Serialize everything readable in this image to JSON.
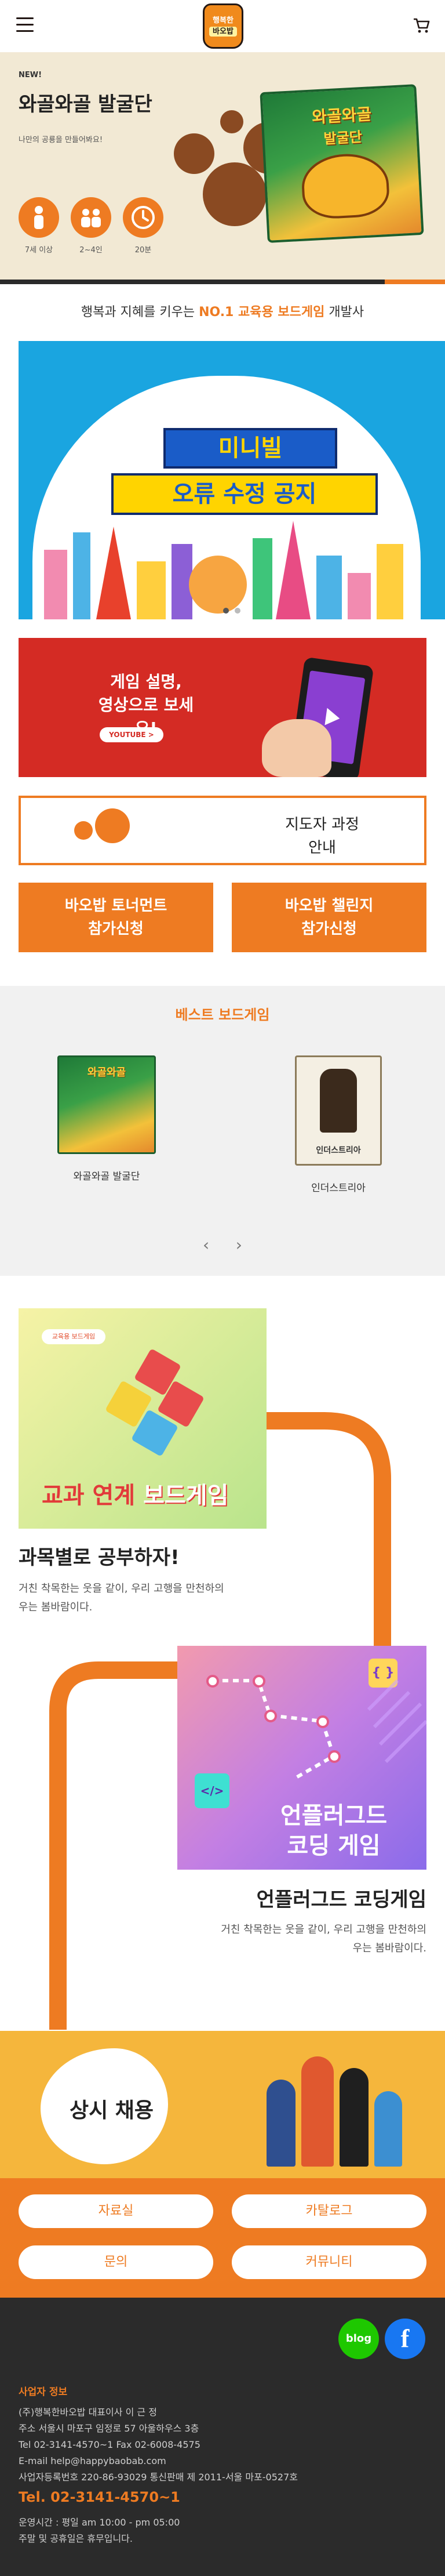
{
  "header": {
    "logo_line1": "행복한",
    "logo_line2": "바오밥"
  },
  "hero": {
    "badge": "NEW!",
    "title": "와골와골 발굴단",
    "subtitle": "나만의 공룡을 만들어봐요!",
    "box_title1": "와골와골",
    "box_title2": "발굴단",
    "stats": [
      {
        "icon": "age-icon",
        "label": "7세 이상"
      },
      {
        "icon": "players-icon",
        "label": "2~4인"
      },
      {
        "icon": "clock-icon",
        "label": "20분"
      }
    ]
  },
  "tagline": {
    "prefix": "행복과 지혜를 키우는 ",
    "highlight": "NO.1 교육용 보드게임",
    "suffix": " 개발사"
  },
  "banner": {
    "title_line1": "미니빌",
    "title_line2": "오류 수정 공지"
  },
  "youtube": {
    "text_line1": "게임 설명,",
    "text_line2": "영상으로 보세요!",
    "button": "YOUTUBE >"
  },
  "instructor": {
    "line1": "지도자 과정",
    "line2": "안내"
  },
  "cta": {
    "left_line1": "바오밥 토너먼트",
    "left_line2": "참가신청",
    "right_line1": "바오밥 챌린지",
    "right_line2": "참가신청"
  },
  "best": {
    "title": "베스트 보드게임",
    "items": [
      {
        "name": "와골와골 발굴단",
        "box_text": "와골와골"
      },
      {
        "name": "인더스트리아",
        "box_text": "인더스트리아"
      }
    ],
    "prev": "‹",
    "next": "›"
  },
  "subjects": [
    {
      "badge": "교육용 보드게임",
      "image_label_red": "교과 연계",
      "image_label_white": " 보드게임",
      "title": "과목별로 공부하자!",
      "desc_line1": "거친 착목한는 웃을 같이, 우리 고행을 만천하의",
      "desc_line2": "우는 봄바람이다."
    },
    {
      "brace": "{ }",
      "code": "</>",
      "image_label1": "언플러그드",
      "image_label2": "코딩 게임",
      "title": "언플러그드 코딩게임",
      "desc_line1": "거친 착목한는 웃을 같이, 우리 고행을 만천하의",
      "desc_line2": "우는 봄바람이다."
    }
  ],
  "recruit": {
    "text": "상시 채용"
  },
  "links": [
    {
      "label": "자료실"
    },
    {
      "label": "카탈로그"
    },
    {
      "label": "문의"
    },
    {
      "label": "커뮤니티"
    }
  ],
  "footer": {
    "blog_label": "blog",
    "fb_label": "f",
    "heading": "사업자 정보",
    "lines": [
      "(주)행복한바오밥 대표이사 이 근 정",
      "주소 서울시 마포구 임정로 57 아울하우스 3층",
      "Tel 02-3141-4570~1     Fax 02-6008-4575",
      "E-mail help@happybaobab.com",
      "사업자등록번호 220-86-93029     통신판매 제 2011-서울 마포-0527호"
    ],
    "tel": "Tel. 02-3141-4570~1",
    "hours_line1": "운영시간 : 평일 am 10:00 - pm 05:00",
    "hours_line2": "주말 및 공휴일은 휴무입니다."
  },
  "colors": {
    "accent": "#ee7b22",
    "dark": "#2b2b2b",
    "banner_blue": "#1aa5e0",
    "youtube_red": "#d42b24",
    "recruit_yellow": "#f5b63c"
  }
}
